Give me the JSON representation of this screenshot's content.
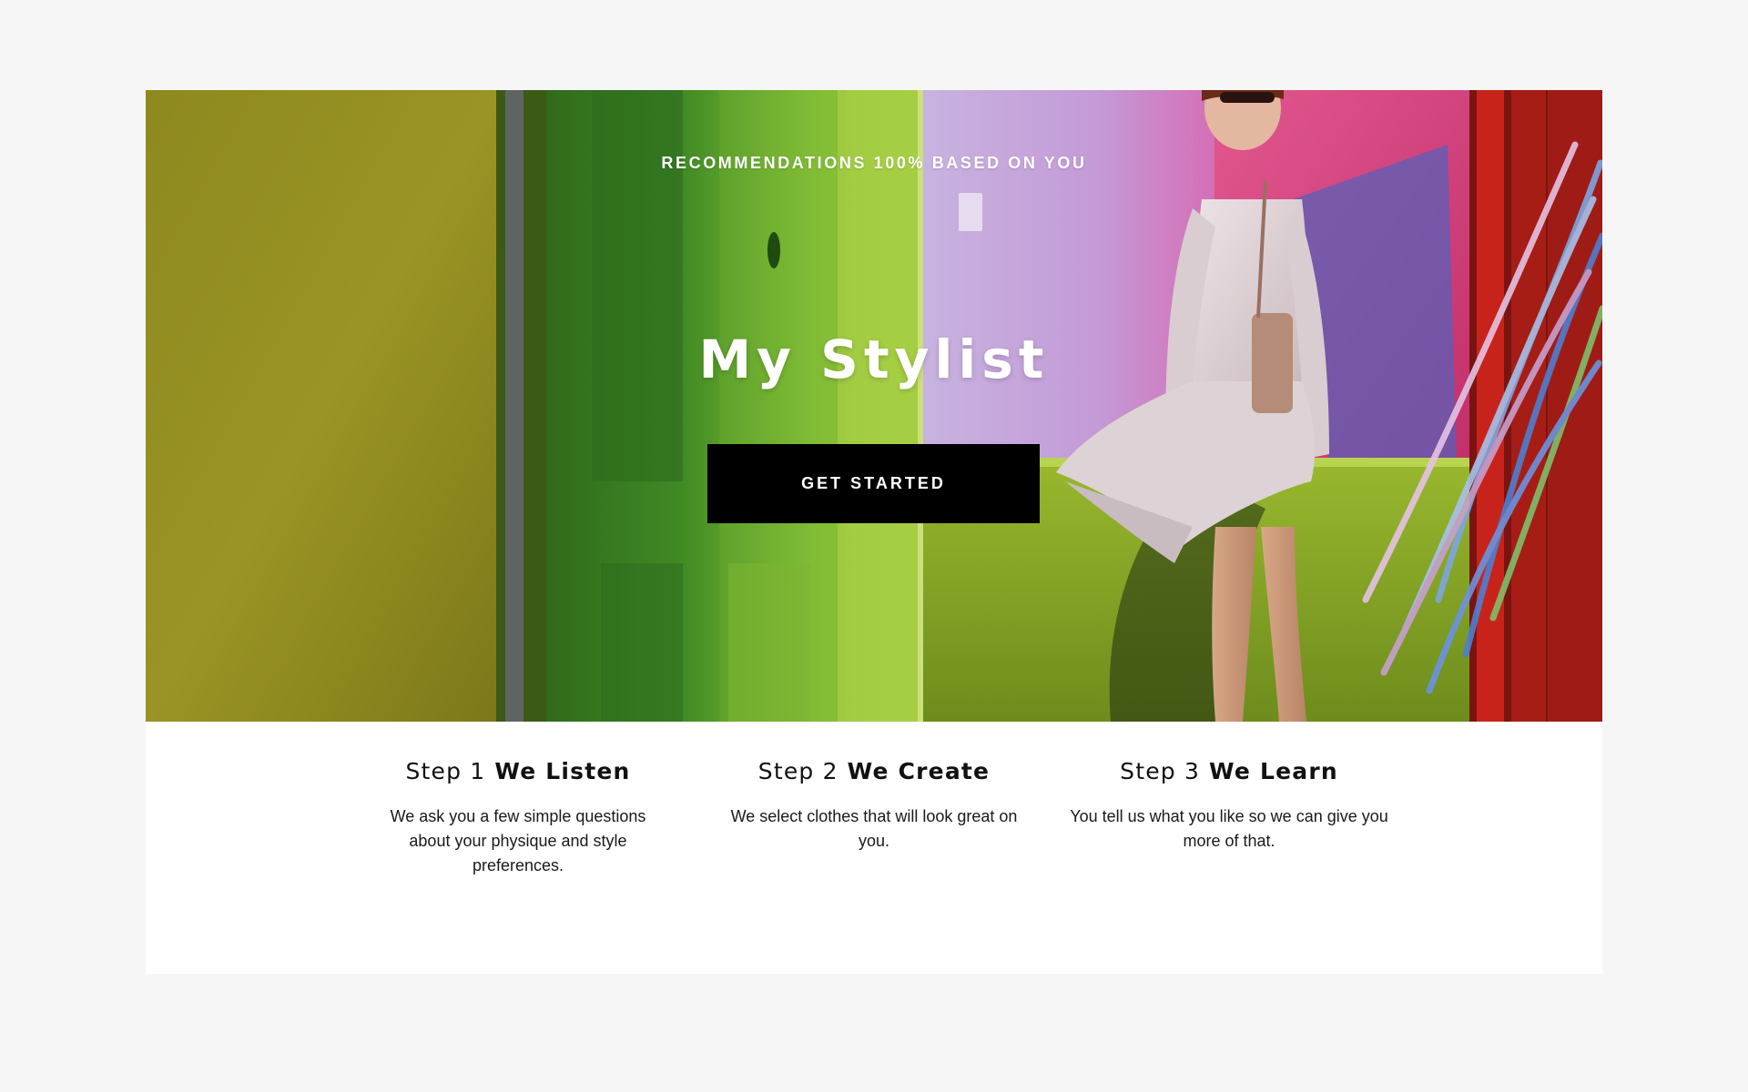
{
  "hero": {
    "eyebrow": "RECOMMENDATIONS 100% BASED ON YOU",
    "title": "My Stylist",
    "cta_label": "GET STARTED"
  },
  "steps": [
    {
      "number": "Step 1",
      "name": "We Listen",
      "body": "We ask you a few simple questions about your physique and style preferences."
    },
    {
      "number": "Step 2",
      "name": "We Create",
      "body": "We select clothes that will look great on you."
    },
    {
      "number": "Step 3",
      "name": "We Learn",
      "body": "You tell us what you like so we can give you more of that."
    }
  ],
  "colors": {
    "page_background": "#f6f6f6",
    "cta_background": "#000000",
    "olive_wall": "#8f8a1f",
    "green_door": "#7fae2a",
    "lavender_wall": "#c8a6d6",
    "pink_wall": "#e04a84",
    "red_frame": "#c8231b"
  }
}
